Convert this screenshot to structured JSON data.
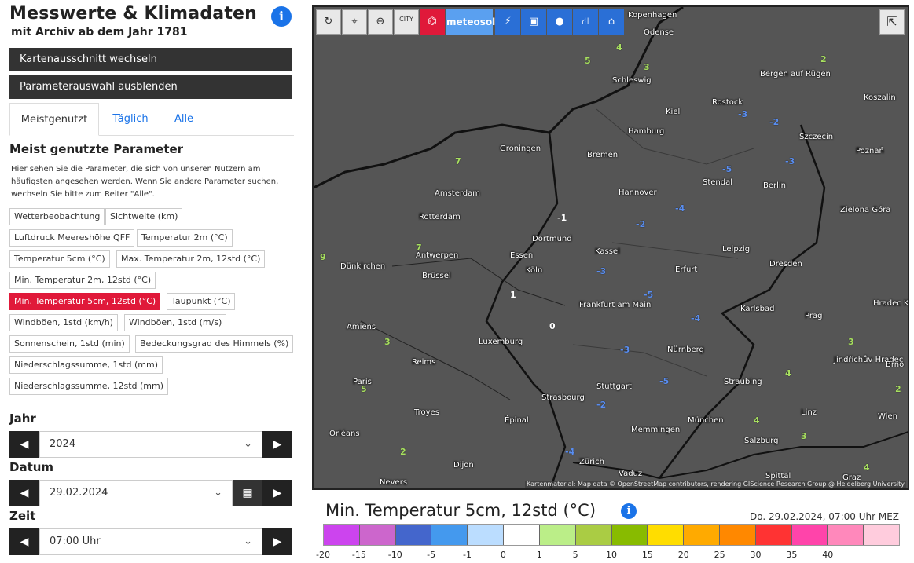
{
  "header": {
    "title": "Messwerte & Klimadaten",
    "subtitle": "mit Archiv ab dem Jahr 1781",
    "info_icon": "i"
  },
  "buttons": {
    "map_section": "Kartenausschnitt wechseln",
    "hide_params": "Parameterauswahl ausblenden"
  },
  "tabs": [
    "Meistgenutzt",
    "Täglich",
    "Alle"
  ],
  "section": {
    "heading": "Meist genutzte Parameter",
    "text": "Hier sehen Sie die Parameter, die sich von unseren Nutzern am häufigsten angesehen werden. Wenn Sie andere Parameter suchen, wechseln Sie bitte zum Reiter \"Alle\"."
  },
  "parameters": [
    "Wetterbeobachtung",
    "Sichtweite (km)",
    "Luftdruck Meereshöhe QFF",
    "Temperatur 2m (°C)",
    "Temperatur 5cm (°C)",
    "Max. Temperatur 2m, 12std (°C)",
    "Min. Temperatur 2m, 12std (°C)",
    "Min. Temperatur 5cm, 12std (°C)",
    "Taupunkt (°C)",
    "Windböen, 1std (km/h)",
    "Windböen, 1std (m/s)",
    "Sonnenschein, 1std (min)",
    "Bedeckungsgrad des Himmels (%)",
    "Niederschlagssumme, 1std (mm)",
    "Niederschlagssumme, 12std (mm)"
  ],
  "selected_parameter": "Min. Temperatur 5cm, 12std (°C)",
  "controls": {
    "year_label": "Jahr",
    "year_value": "2024",
    "date_label": "Datum",
    "date_value": "29.02.2024",
    "time_label": "Zeit",
    "time_value": "07:00 Uhr"
  },
  "map": {
    "toolbar_meteo": "meteosol",
    "toolbar_city": "CITY",
    "attribution": "Kartenmaterial: Map data © OpenStreetMap contributors, rendering GIScience Research Group @ Heidelberg University",
    "cities": [
      "Kopenhagen",
      "Odense",
      "Schleswig",
      "Bergen auf Rügen",
      "Rostock",
      "Kiel",
      "Hamburg",
      "Koszalin",
      "Szczecin",
      "Groningen",
      "Bremen",
      "Stendal",
      "Berlin",
      "Amsterdam",
      "Hannover",
      "Rotterdam",
      "Dortmund",
      "Kassel",
      "Leipzig",
      "Dresden",
      "Zielona Góra",
      "Antwerpen",
      "Brüssel",
      "Köln",
      "Essen",
      "Erfurt",
      "Dünkirchen",
      "Frankfurt am Main",
      "Karlsbad",
      "Prag",
      "Hradec Králové",
      "Amiens",
      "Luxemburg",
      "Nürnberg",
      "Reims",
      "Jindřichův Hradec",
      "Brno",
      "Paris",
      "Straubing",
      "Strasbourg",
      "Stuttgart",
      "Troyes",
      "Épinal",
      "Linz",
      "Wien",
      "Orléans",
      "München",
      "Memmingen",
      "Salzburg",
      "Dijon",
      "Zürich",
      "Vaduz",
      "Nevers",
      "Spittal",
      "Graz",
      "Poznań"
    ]
  },
  "legend": {
    "title": "Min. Temperatur 5cm, 12std (°C)",
    "date": "Do. 29.02.2024, 07:00 Uhr MEZ",
    "ticks": [
      "-20",
      "-15",
      "-10",
      "-5",
      "-1",
      "0",
      "1",
      "5",
      "10",
      "15",
      "20",
      "25",
      "30",
      "35",
      "40"
    ],
    "colors": [
      "#cc44ee",
      "#cc66cc",
      "#4466cc",
      "#4499ee",
      "#bbddff",
      "#ffffff",
      "#bbee88",
      "#aacc44",
      "#88bb00",
      "#ffdd00",
      "#ffaa00",
      "#ff8800",
      "#ff3333",
      "#ff44aa",
      "#ff88bb",
      "#ffccdd"
    ]
  }
}
